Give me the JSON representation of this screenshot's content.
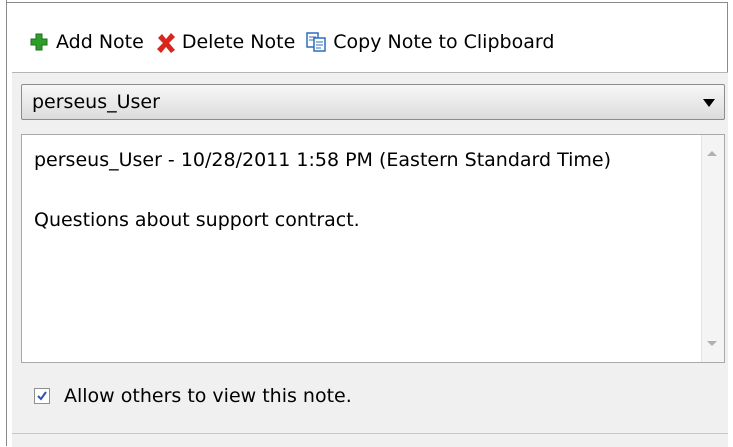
{
  "toolbar": {
    "add_label": "Add Note",
    "delete_label": "Delete Note",
    "copy_label": "Copy Note to Clipboard",
    "add_icon": "plus-icon",
    "delete_icon": "x-icon",
    "copy_icon": "copy-icon",
    "add_color": "#2e9e2a",
    "delete_color": "#d9261c",
    "copy_color": "#2f6fbd"
  },
  "user_select": {
    "selected": "perseus_User"
  },
  "note": {
    "header": "perseus_User - 10/28/2011 1:58 PM (Eastern Standard Time)",
    "body": "Questions about support contract."
  },
  "allow_others": {
    "label": "Allow others to view this note.",
    "checked": true
  }
}
